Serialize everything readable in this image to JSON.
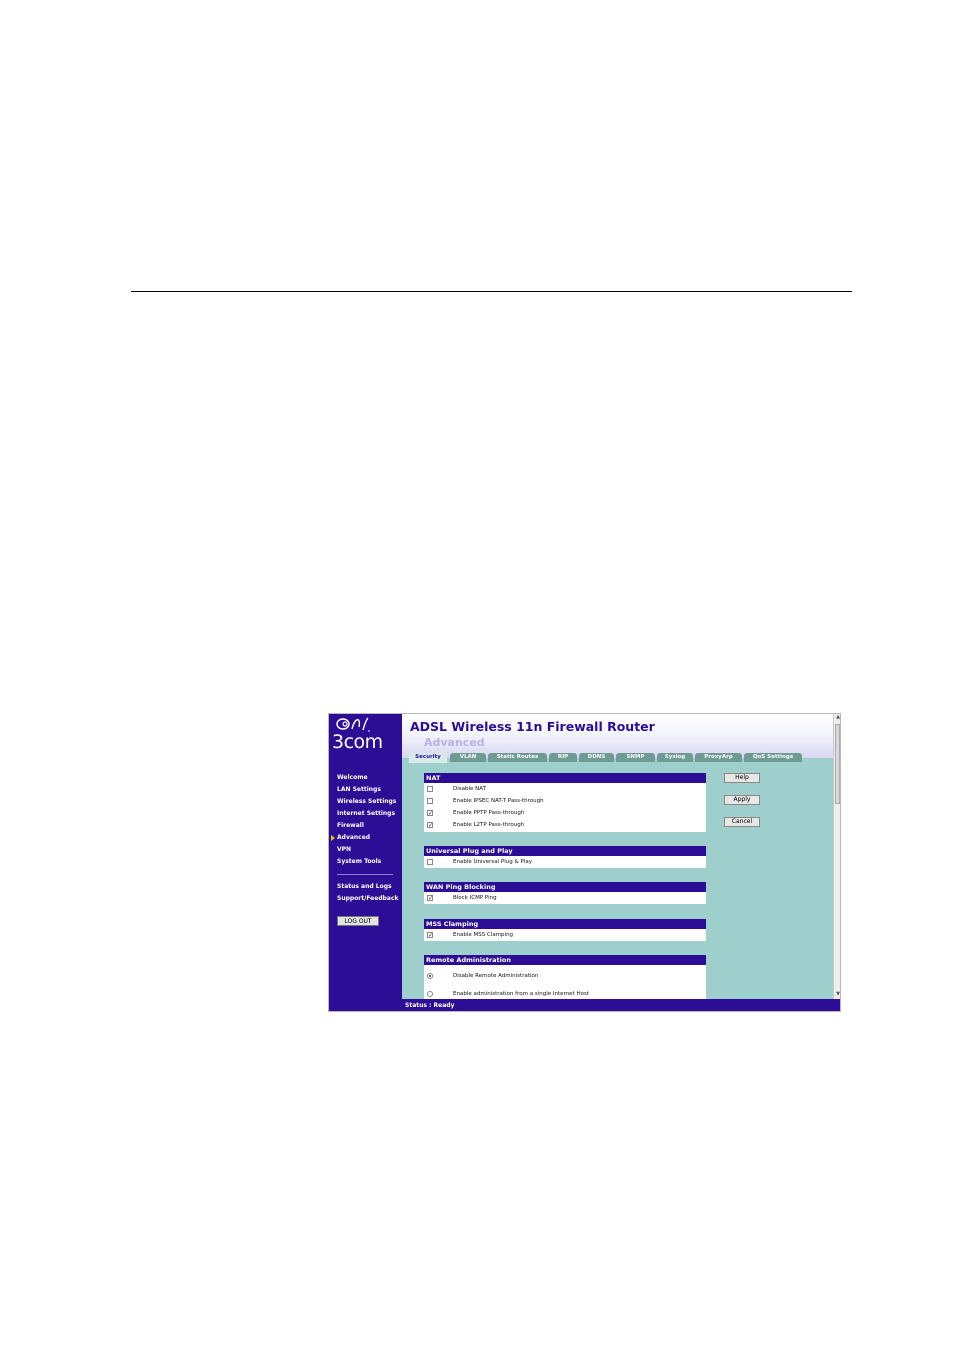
{
  "brand": {
    "logo_text": "3com"
  },
  "header": {
    "title": "ADSL Wireless 11n Firewall Router",
    "subtitle": "Advanced"
  },
  "tabs": [
    {
      "label": "Security",
      "active": true
    },
    {
      "label": "VLAN"
    },
    {
      "label": "Static Routes"
    },
    {
      "label": "RIP"
    },
    {
      "label": "DDNS"
    },
    {
      "label": "SNMP"
    },
    {
      "label": "Syslog"
    },
    {
      "label": "ProxyArp"
    },
    {
      "label": "QoS Settings"
    }
  ],
  "sidebar": {
    "items": [
      {
        "label": "Welcome"
      },
      {
        "label": "LAN Settings"
      },
      {
        "label": "Wireless Settings"
      },
      {
        "label": "Internet Settings"
      },
      {
        "label": "Firewall"
      },
      {
        "label": "Advanced",
        "active": true
      },
      {
        "label": "VPN"
      },
      {
        "label": "System Tools"
      },
      {
        "label": "Status and Logs"
      },
      {
        "label": "Support/Feedback"
      }
    ],
    "logout_label": "LOG OUT"
  },
  "sections": {
    "nat": {
      "title": "NAT",
      "options": [
        {
          "label": "Disable NAT",
          "checked": false
        },
        {
          "label": "Enable IPSEC NAT-T Pass-through",
          "checked": false
        },
        {
          "label": "Enable PPTP Pass-through",
          "checked": true
        },
        {
          "label": "Enable L2TP Pass-through",
          "checked": true
        }
      ]
    },
    "upnp": {
      "title": "Universal Plug and Play",
      "options": [
        {
          "label": "Enable Universal Plug & Play",
          "checked": false
        }
      ]
    },
    "wan_ping": {
      "title": "WAN Ping Blocking",
      "options": [
        {
          "label": "Block ICMP Ping",
          "checked": true
        }
      ]
    },
    "mss": {
      "title": "MSS Clamping",
      "options": [
        {
          "label": "Enable MSS Clamping",
          "checked": true
        }
      ]
    },
    "remote_admin": {
      "title": "Remote Administration",
      "options": [
        {
          "label": "Disable Remote Administration",
          "selected": true
        },
        {
          "label": "Enable administration from a single Internet Host",
          "selected": false
        }
      ]
    }
  },
  "buttons": {
    "help": "Help",
    "apply": "Apply",
    "cancel": "Cancel"
  },
  "status": {
    "text": "Status : Ready"
  },
  "scrollbar": {
    "up": "▲",
    "down": "▼"
  }
}
